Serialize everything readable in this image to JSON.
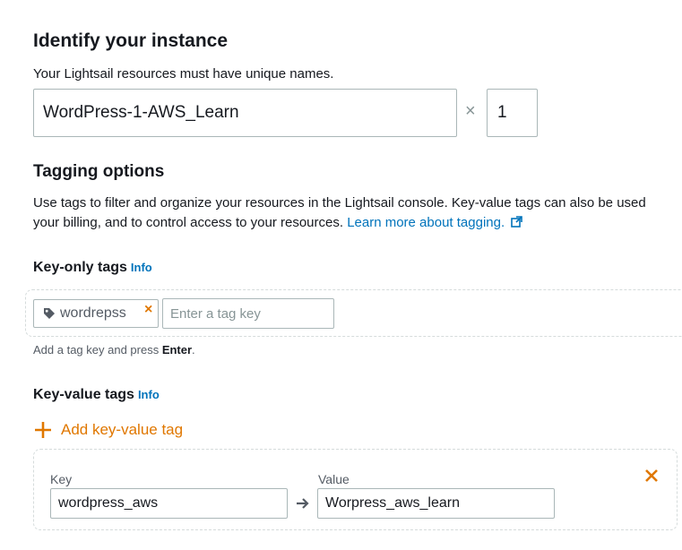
{
  "identify": {
    "title": "Identify your instance",
    "description": "Your Lightsail resources must have unique names.",
    "name_value": "WordPress-1-AWS_Learn",
    "multiply_symbol": "×",
    "count_value": "1"
  },
  "tagging": {
    "title": "Tagging options",
    "description_line1": "Use tags to filter and organize your resources in the Lightsail console. Key-value tags can also be used",
    "description_line2": "your billing, and to control access to your resources.",
    "learn_more": "Learn more about tagging."
  },
  "key_only": {
    "title": "Key-only tags",
    "info": "Info",
    "tags": [
      "wordrepss"
    ],
    "remove_symbol": "×",
    "input_placeholder": "Enter a tag key",
    "hint_prefix": "Add a tag key and press ",
    "hint_key": "Enter",
    "hint_suffix": "."
  },
  "key_value": {
    "title": "Key-value tags",
    "info": "Info",
    "add_label": "Add key-value tag",
    "key_label": "Key",
    "value_label": "Value",
    "key_value": "wordpress_aws",
    "value_value": "Worpress_aws_learn",
    "accent_color": "#e07700"
  }
}
